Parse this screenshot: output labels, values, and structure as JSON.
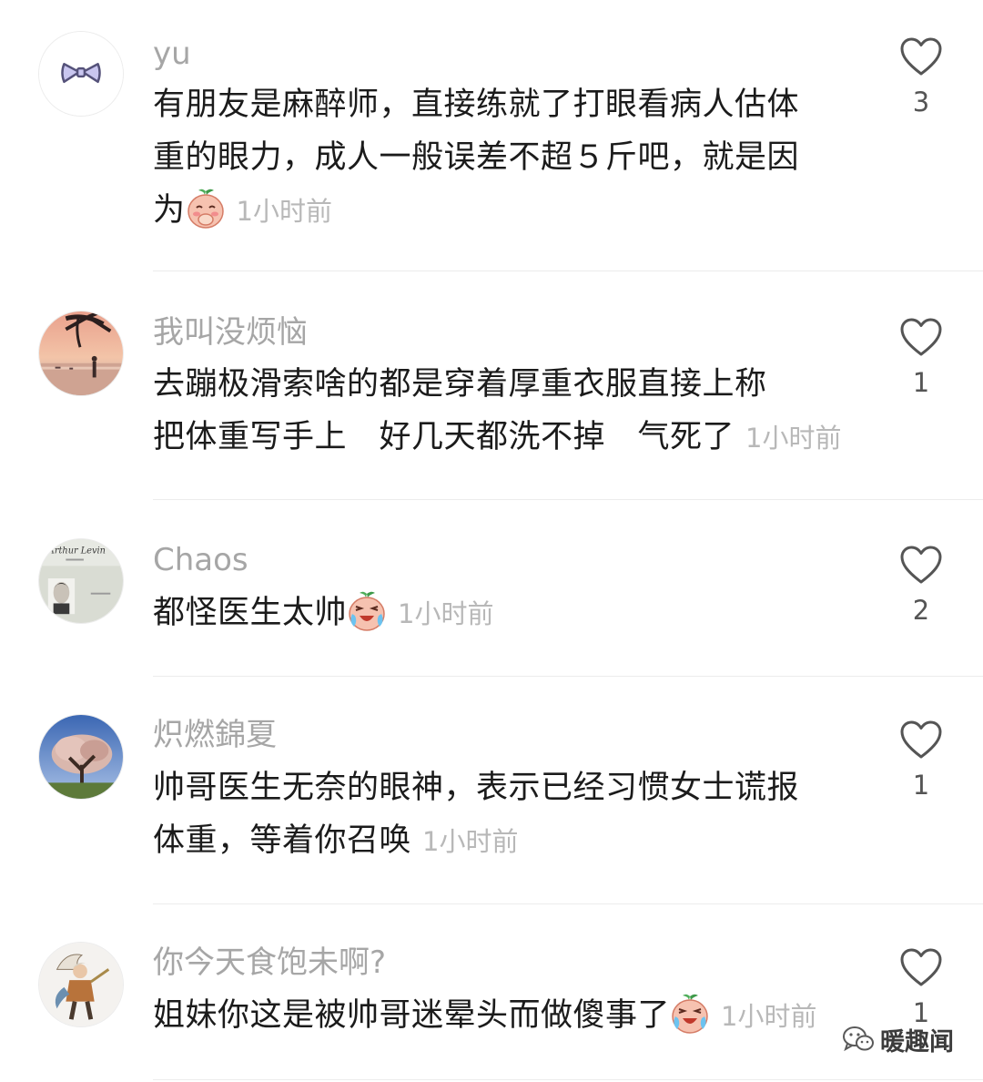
{
  "comments": [
    {
      "username": "yu",
      "lines": [
        "有朋友是麻醉师，直接练就了打眼看病人估体",
        "重的眼力，成人一般误差不超５斤吧，就是因",
        "为"
      ],
      "emoji": "shy-covering-mouth-emoji",
      "time": "1小时前",
      "likes": "3",
      "avatar": "bow-tie-avatar"
    },
    {
      "username": "我叫没烦恼",
      "lines": [
        "去蹦极滑索啥的都是穿着厚重衣服直接上称",
        "把体重写手上　好几天都洗不掉　气死了"
      ],
      "time": "1小时前",
      "likes": "1",
      "avatar": "beach-sunset-avatar"
    },
    {
      "username": "Chaos",
      "lines": [
        "都怪医生太帅"
      ],
      "emoji": "laughing-crying-emoji",
      "time": "1小时前",
      "likes": "2",
      "avatar": "book-cover-avatar"
    },
    {
      "username": "炽燃錦夏",
      "lines": [
        "帅哥医生无奈的眼神，表示已经习惯女士谎报",
        "体重，等着你召唤"
      ],
      "time": "1小时前",
      "likes": "1",
      "avatar": "blossom-tree-avatar"
    },
    {
      "username": "你今天食饱未啊?",
      "lines": [
        "姐妹你这是被帅哥迷晕头而做傻事了"
      ],
      "emoji": "laughing-crying-emoji",
      "time": "1小时前",
      "likes": "1",
      "avatar": "game-character-avatar"
    }
  ],
  "watermark": {
    "text": "暖趣闻",
    "icon": "wechat-icon"
  },
  "colors": {
    "username": "#a6a6a6",
    "time": "#b8b8b8",
    "divider": "#ececec",
    "text": "#1b1b1b"
  }
}
